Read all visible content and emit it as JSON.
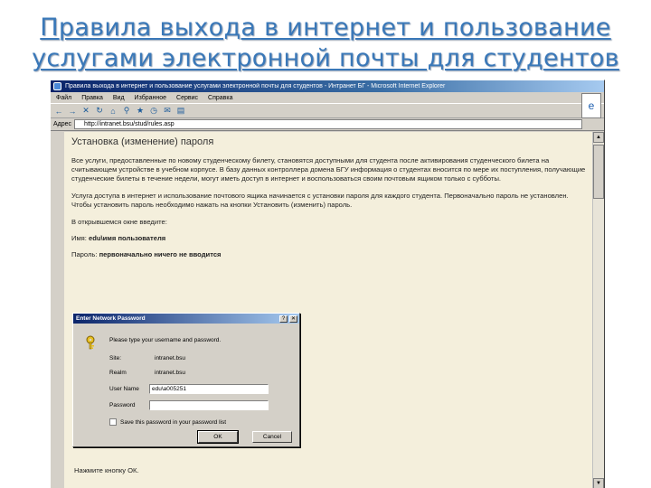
{
  "slide": {
    "title_line1": "Правила выхода в интернет и пользование",
    "title_line2": "услугами электронной почты для студентов"
  },
  "browser": {
    "window_title": "Правила выхода в интернет и пользование услугами электронной почты для студентов - Интранет БГ - Microsoft Internet Explorer",
    "menu": [
      "Файл",
      "Правка",
      "Вид",
      "Избранное",
      "Сервис",
      "Справка"
    ],
    "address_label": "Адрес",
    "address_url": "http://intranet.bsu/stud/rules.asp"
  },
  "page": {
    "heading": "Установка (изменение) пароля",
    "paragraph1": "Все услуги, предоставленные по новому студенческому билету, становятся доступными для студента после активирования студенческого билета на считывающем устройстве в учебном корпусе. В базу данных контроллера домена БГУ информация о студентах вносится по мере их поступления, получающие студенческие билеты в течение недели, могут иметь доступ в интернет и воспользоваться своим почтовым ящиком только с субботы.",
    "paragraph2": "Услуга доступа в интернет и использование почтового ящика начинается с установки пароля для каждого студента. Первоначально пароль не установлен. Чтобы установить пароль необходимо нажать на кнопки Установить (изменить) пароль.",
    "prompt_line": "В открывшемся окне введите:",
    "name_label": "Имя:",
    "name_value": "edu\\имя пользователя",
    "password_label": "Пароль:",
    "password_value": "первоначально ничего не вводится",
    "footer": "Нажмите кнопку ОК."
  },
  "dialog": {
    "title": "Enter Network Password",
    "prompt": "Please type your username and password.",
    "site_label": "Site:",
    "site_value": "intranet.bsu",
    "realm_label": "Realm",
    "realm_value": "intranet.bsu",
    "username_label": "User Name",
    "username_value": "edu\\a005251",
    "password_label": "Password",
    "password_value": "",
    "save_label": "Save this password in your password list",
    "ok_label": "OK",
    "cancel_label": "Cancel",
    "help_glyph": "?",
    "close_glyph": "✕"
  },
  "colors": {
    "title_blue": "#3a78b8",
    "page_bg": "#f4efdc",
    "dialog_bg": "#d4d0c8"
  }
}
